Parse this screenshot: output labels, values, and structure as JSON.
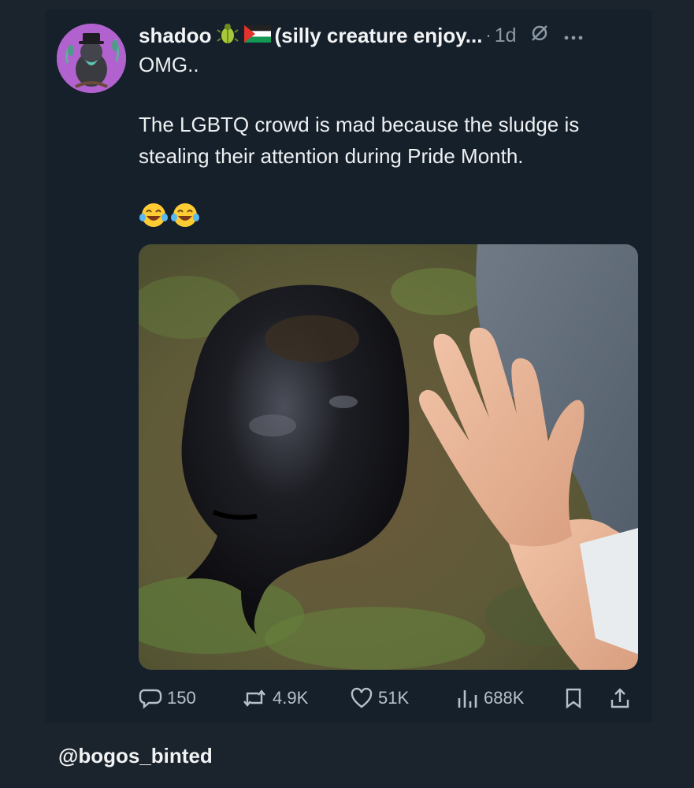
{
  "post": {
    "display_name": "shadoo",
    "name_suffix": "(silly creature enjoy...",
    "separator": "·",
    "time": "1d",
    "text_lines": [
      "OMG..",
      "The LGBTQ crowd is mad because the sludge is",
      "stealing their attention during Pride Month."
    ],
    "emoji_count": 2
  },
  "actions": {
    "replies": "150",
    "reposts": "4.9K",
    "likes": "51K",
    "views": "688K"
  },
  "watermark": "@bogos_binted",
  "icons": [
    "avatar",
    "bug-emoji-icon",
    "palestine-flag-icon",
    "muted-icon",
    "more-icon",
    "reply-icon",
    "repost-icon",
    "like-icon",
    "views-icon",
    "bookmark-icon",
    "share-icon",
    "laughing-emoji-icon"
  ],
  "colors": {
    "background": "#15202b",
    "outer": "#1b232c",
    "text": "#e7e9ea",
    "muted": "#8b98a5",
    "avatar_bg": "#b262cf"
  }
}
